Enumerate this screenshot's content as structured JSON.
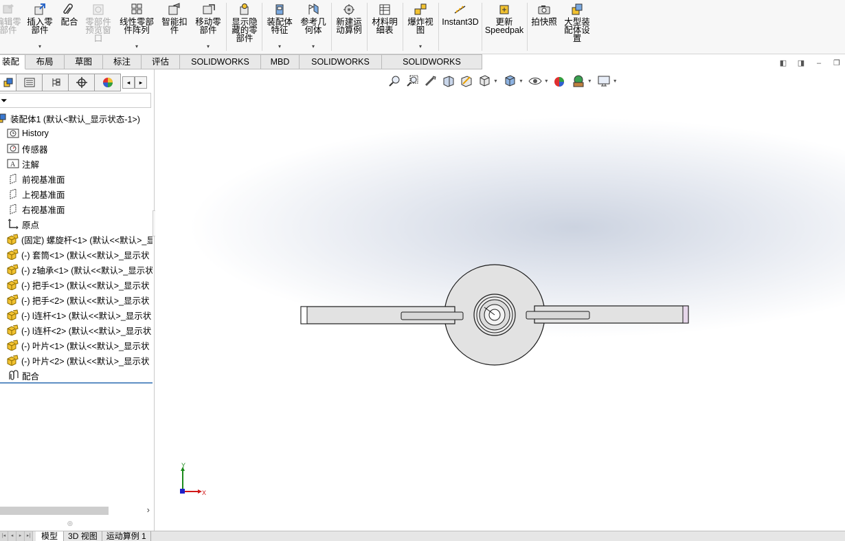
{
  "ribbon": {
    "buttons": [
      {
        "id": "edit-component",
        "label": "编辑零\n部件",
        "icon": "edit-component-icon",
        "disabled": true,
        "dropdown": false
      },
      {
        "id": "insert-components",
        "label": "插入零\n部件",
        "icon": "insert-components-icon",
        "disabled": false,
        "dropdown": true
      },
      {
        "id": "mate",
        "label": "配合",
        "icon": "paperclip-icon",
        "disabled": false,
        "dropdown": false
      },
      {
        "id": "component-preview",
        "label": "零部件\n预览窗\n口",
        "icon": "preview-window-icon",
        "disabled": true,
        "dropdown": false
      },
      {
        "id": "linear-pattern",
        "label": "线性零部\n件阵列",
        "icon": "linear-pattern-icon",
        "disabled": false,
        "dropdown": true
      },
      {
        "id": "smart-fasteners",
        "label": "智能扣\n件",
        "icon": "smart-fasteners-icon",
        "disabled": false,
        "dropdown": false
      },
      {
        "id": "move-component",
        "label": "移动零\n部件",
        "icon": "move-component-icon",
        "disabled": false,
        "dropdown": true
      },
      {
        "id": "show-hidden",
        "label": "显示隐\n藏的零\n部件",
        "icon": "show-hidden-icon",
        "disabled": false,
        "dropdown": false
      },
      {
        "id": "assembly-features",
        "label": "装配体\n特征",
        "icon": "assembly-features-icon",
        "disabled": false,
        "dropdown": true
      },
      {
        "id": "reference-geometry",
        "label": "参考几\n何体",
        "icon": "reference-geometry-icon",
        "disabled": false,
        "dropdown": true
      },
      {
        "id": "new-motion-study",
        "label": "新建运\n动算例",
        "icon": "motion-study-icon",
        "disabled": false,
        "dropdown": false
      },
      {
        "id": "bom",
        "label": "材料明\n细表",
        "icon": "bom-icon",
        "disabled": false,
        "dropdown": false
      },
      {
        "id": "exploded-view",
        "label": "爆炸视\n图",
        "icon": "exploded-view-icon",
        "disabled": false,
        "dropdown": true
      },
      {
        "id": "instant3d",
        "label": "Instant3D",
        "icon": "instant3d-icon",
        "disabled": false,
        "dropdown": false
      },
      {
        "id": "update-speedpak",
        "label": "更新\nSpeedpak",
        "icon": "speedpak-icon",
        "disabled": false,
        "dropdown": false
      },
      {
        "id": "snapshot",
        "label": "拍快照",
        "icon": "camera-icon",
        "disabled": false,
        "dropdown": false
      },
      {
        "id": "large-assembly",
        "label": "大型装\n配体设\n置",
        "icon": "large-assembly-icon",
        "disabled": false,
        "dropdown": false
      }
    ]
  },
  "tabs": [
    {
      "label": "装配体",
      "active": true
    },
    {
      "label": "布局",
      "active": false
    },
    {
      "label": "草图",
      "active": false
    },
    {
      "label": "标注",
      "active": false
    },
    {
      "label": "评估",
      "active": false
    },
    {
      "label": "SOLIDWORKS 插件",
      "active": false
    },
    {
      "label": "MBD",
      "active": false
    },
    {
      "label": "SOLIDWORKS CAM",
      "active": false
    },
    {
      "label": "SOLIDWORKS Inspection",
      "active": false
    }
  ],
  "tree": {
    "root": "装配体1  (默认<默认_显示状态-1>)",
    "items": [
      {
        "label": "History",
        "icon": "history-icon",
        "kind": "folder"
      },
      {
        "label": "传感器",
        "icon": "sensor-icon",
        "kind": "folder"
      },
      {
        "label": "注解",
        "icon": "annotation-icon",
        "kind": "folder"
      },
      {
        "label": "前视基准面",
        "icon": "plane-icon",
        "kind": "plane"
      },
      {
        "label": "上视基准面",
        "icon": "plane-icon",
        "kind": "plane"
      },
      {
        "label": "右视基准面",
        "icon": "plane-icon",
        "kind": "plane"
      },
      {
        "label": "原点",
        "icon": "origin-icon",
        "kind": "origin"
      },
      {
        "label": "(固定) 螺旋杆<1> (默认<<默认>_显",
        "icon": "part-icon",
        "kind": "comp"
      },
      {
        "label": "(-) 套筒<1> (默认<<默认>_显示状",
        "icon": "part-icon",
        "kind": "comp"
      },
      {
        "label": "(-) z轴承<1> (默认<<默认>_显示状",
        "icon": "part-icon",
        "kind": "comp"
      },
      {
        "label": "(-) 把手<1> (默认<<默认>_显示状",
        "icon": "part-icon",
        "kind": "comp"
      },
      {
        "label": "(-) 把手<2> (默认<<默认>_显示状",
        "icon": "part-icon",
        "kind": "comp"
      },
      {
        "label": "(-) l连杆<1> (默认<<默认>_显示状",
        "icon": "part-icon",
        "kind": "comp"
      },
      {
        "label": "(-) l连杆<2> (默认<<默认>_显示状",
        "icon": "part-icon",
        "kind": "comp"
      },
      {
        "label": "(-) 叶片<1> (默认<<默认>_显示状",
        "icon": "part-icon",
        "kind": "comp"
      },
      {
        "label": "(-) 叶片<2> (默认<<默认>_显示状",
        "icon": "part-icon",
        "kind": "comp"
      },
      {
        "label": "配合",
        "icon": "mates-icon",
        "kind": "mates"
      }
    ]
  },
  "triad": {
    "x_label": "X",
    "y_label": "Y"
  },
  "bottom_tabs": [
    {
      "label": "模型",
      "active": true
    },
    {
      "label": "3D 视图",
      "active": false
    },
    {
      "label": "运动算例 1",
      "active": false
    }
  ],
  "colors": {
    "accent": "#5e8fc4",
    "part_yellow": "#f2c230",
    "part_face": "#e4e4e4"
  }
}
